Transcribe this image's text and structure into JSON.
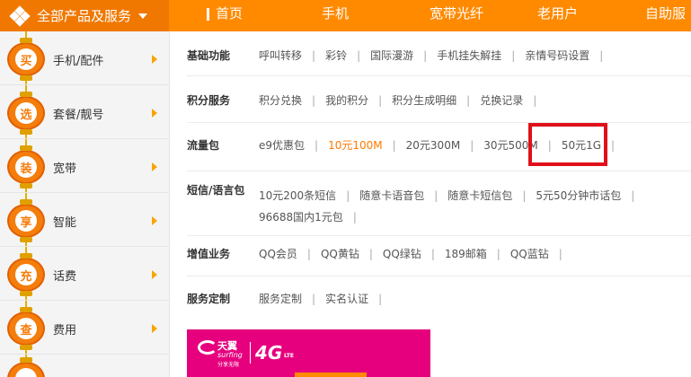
{
  "nav": {
    "all_products": "全部产品及服务",
    "items": [
      "首页",
      "手机",
      "宽带光纤",
      "老用户",
      "自助服"
    ]
  },
  "sidebar": {
    "items": [
      {
        "badge": "买",
        "label": "手机/配件"
      },
      {
        "badge": "选",
        "label": "套餐/靓号"
      },
      {
        "badge": "装",
        "label": "宽带"
      },
      {
        "badge": "享",
        "label": "智能"
      },
      {
        "badge": "充",
        "label": "话费"
      },
      {
        "badge": "查",
        "label": "费用"
      }
    ]
  },
  "services": [
    {
      "label": "基础功能",
      "items": [
        "呼叫转移",
        "彩铃",
        "国际漫游",
        "手机挂失解挂",
        "亲情号码设置"
      ]
    },
    {
      "label": "积分服务",
      "items": [
        "积分兑换",
        "我的积分",
        "积分生成明细",
        "兑换记录"
      ]
    },
    {
      "label": "流量包",
      "items": [
        "e9优惠包",
        "10元100M",
        "20元300M",
        "30元500M",
        "50元1G"
      ],
      "highlight": "10元100M"
    },
    {
      "label": "短信/语言包",
      "items": [
        "10元200条短信",
        "随意卡语音包",
        "随意卡短信包",
        "5元50分钟市话包",
        "96688国内1元包"
      ]
    },
    {
      "label": "增值业务",
      "items": [
        "QQ会员",
        "QQ黄钻",
        "QQ绿钻",
        "189邮箱",
        "QQ蓝钻"
      ]
    },
    {
      "label": "服务定制",
      "items": [
        "服务定制",
        "实名认证"
      ]
    }
  ],
  "banner": {
    "brand": "天翼",
    "brand_en": "surfing",
    "tagline": "分享无限",
    "network": "4G",
    "lte": "LTE"
  },
  "colors": {
    "nav_orange": "#ff8a00",
    "highlight_orange": "#ff7a00",
    "selection_red": "#e0101a",
    "banner_pink": "#e6007e"
  }
}
